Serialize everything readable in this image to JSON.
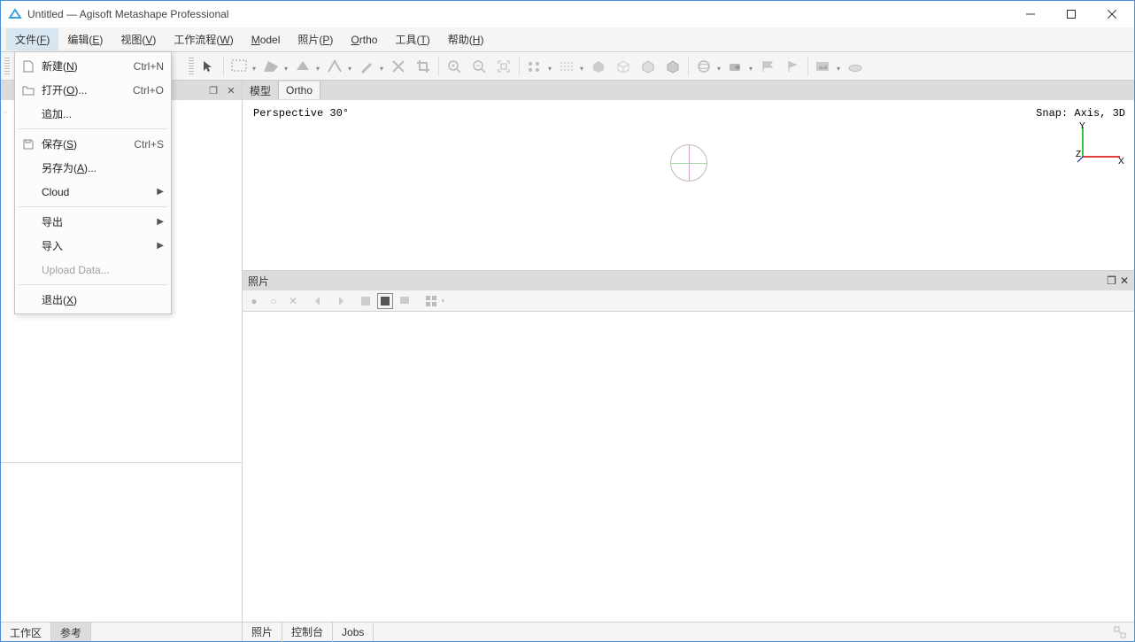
{
  "window": {
    "title": "Untitled — Agisoft Metashape Professional"
  },
  "menubar": {
    "file": "文件(F)",
    "edit": "编辑(E)",
    "view": "视图(V)",
    "workflow": "工作流程(W)",
    "model": "Model",
    "photo": "照片(P)",
    "ortho": "Ortho",
    "tools": "工具(T)",
    "help": "帮助(H)"
  },
  "file_menu": {
    "new": {
      "label": "新建(N)",
      "shortcut": "Ctrl+N"
    },
    "open": {
      "label": "打开(O)...",
      "shortcut": "Ctrl+O"
    },
    "append": {
      "label": "追加..."
    },
    "save": {
      "label": "保存(S)",
      "shortcut": "Ctrl+S"
    },
    "saveas": {
      "label": "另存为(A)..."
    },
    "cloud": {
      "label": "Cloud"
    },
    "export": {
      "label": "导出"
    },
    "import": {
      "label": "导入"
    },
    "upload": {
      "label": "Upload Data..."
    },
    "exit": {
      "label": "退出(X)"
    }
  },
  "left_panel": {
    "tabs": {
      "workspace": "工作区",
      "reference": "参考"
    }
  },
  "viewport": {
    "tabs": {
      "model": "模型",
      "ortho": "Ortho"
    },
    "perspective_label": "Perspective 30°",
    "snap_label": "Snap: Axis, 3D",
    "axes": {
      "x": "X",
      "y": "Y",
      "z": "Z"
    }
  },
  "photos_panel": {
    "title": "照片"
  },
  "statusbar": {
    "left_tabs": {
      "workspace": "工作区",
      "reference": "参考"
    },
    "right_tabs": {
      "photos": "照片",
      "console": "控制台",
      "jobs": "Jobs"
    }
  }
}
